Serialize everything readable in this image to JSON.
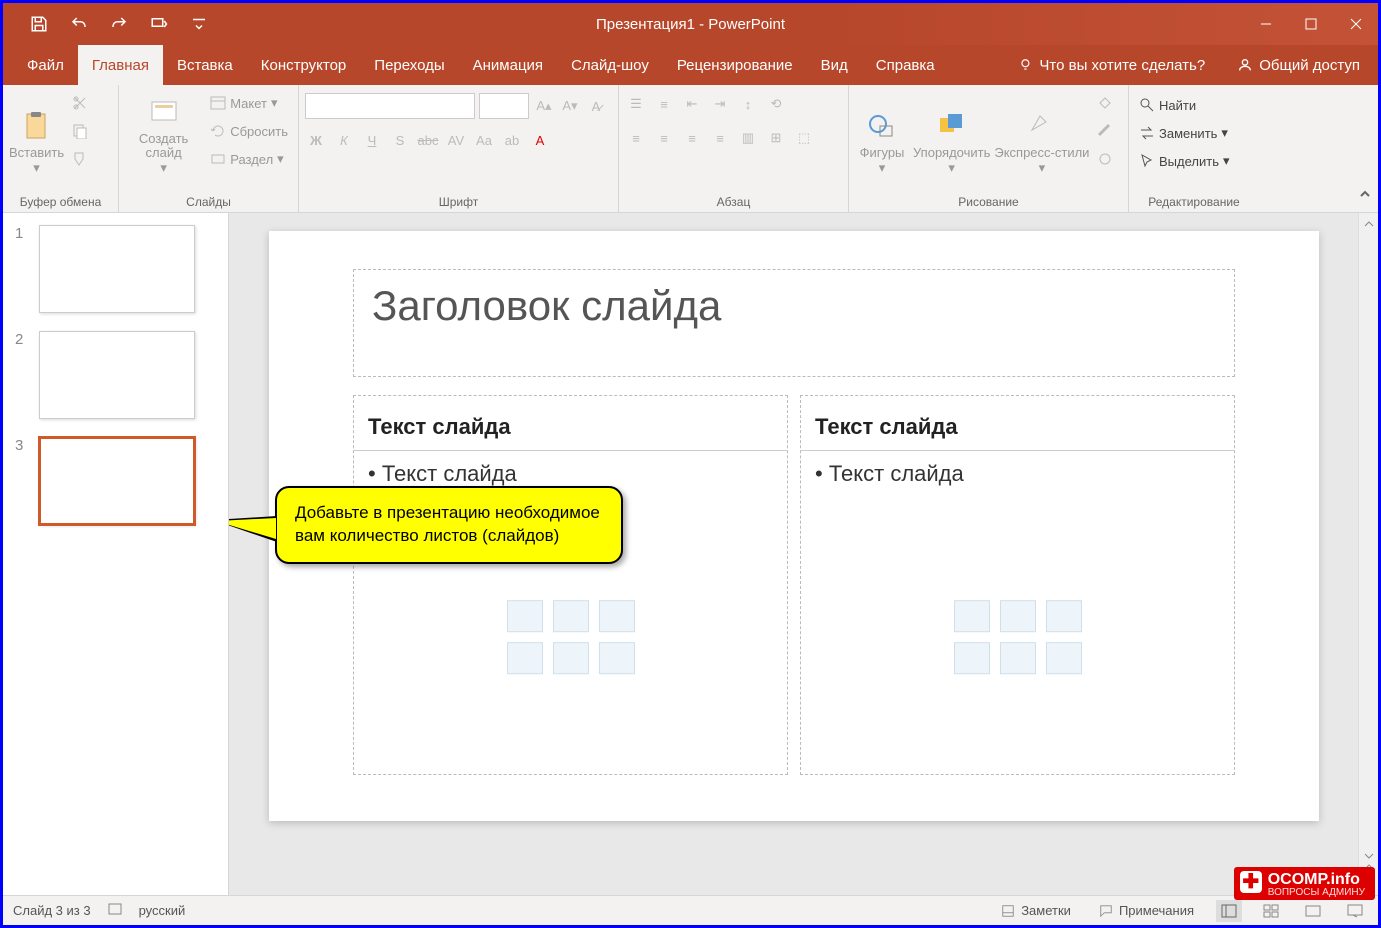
{
  "title": "Презентация1 - PowerPoint",
  "tabs": {
    "file": "Файл",
    "home": "Главная",
    "insert": "Вставка",
    "design": "Конструктор",
    "transitions": "Переходы",
    "animations": "Анимация",
    "slideshow": "Слайд-шоу",
    "review": "Рецензирование",
    "view": "Вид",
    "help": "Справка"
  },
  "tellme": "Что вы хотите сделать?",
  "share": "Общий доступ",
  "ribbon": {
    "clipboard": {
      "label": "Буфер обмена",
      "paste": "Вставить"
    },
    "slides": {
      "label": "Слайды",
      "new": "Создать слайд",
      "layout": "Макет",
      "reset": "Сбросить",
      "section": "Раздел"
    },
    "font": {
      "label": "Шрифт"
    },
    "paragraph": {
      "label": "Абзац"
    },
    "drawing": {
      "label": "Рисование",
      "shapes": "Фигуры",
      "arrange": "Упорядочить",
      "styles": "Экспресс-стили"
    },
    "editing": {
      "label": "Редактирование",
      "find": "Найти",
      "replace": "Заменить",
      "select": "Выделить"
    }
  },
  "thumbs": [
    {
      "num": "1"
    },
    {
      "num": "2"
    },
    {
      "num": "3"
    }
  ],
  "slide": {
    "title": "Заголовок слайда",
    "leftHeader": "Текст слайда",
    "leftBullet": "• Текст слайда",
    "rightHeader": "Текст слайда",
    "rightBullet": "• Текст слайда"
  },
  "callout": "Добавьте в презентацию необходимое вам количество листов (слайдов)",
  "status": {
    "slide": "Слайд 3 из 3",
    "lang": "русский",
    "notes": "Заметки",
    "comments": "Примечания"
  },
  "watermark": {
    "main": "OCOMP.info",
    "sub": "ВОПРОСЫ АДМИНУ"
  }
}
